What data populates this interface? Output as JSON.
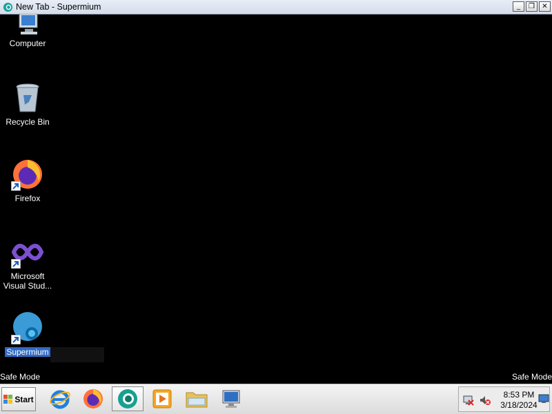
{
  "window": {
    "title": "New Tab - Supermium",
    "app_icon": "supermium-icon"
  },
  "desktop": {
    "icons": [
      {
        "label": "Computer",
        "icon": "computer-icon"
      },
      {
        "label": "Recycle Bin",
        "icon": "recycle-bin-icon"
      },
      {
        "label": "Firefox",
        "icon": "firefox-icon"
      },
      {
        "label": "Microsoft Visual Stud...",
        "icon": "visual-studio-icon"
      },
      {
        "label": "Supermium",
        "icon": "supermium-icon",
        "selected": true
      }
    ],
    "safe_mode_left": "Safe Mode",
    "safe_mode_right": "Safe Mode"
  },
  "taskbar": {
    "start_label": "Start",
    "pinned": [
      "internet-explorer-icon",
      "firefox-icon",
      "supermium-icon",
      "media-player-icon",
      "file-explorer-icon",
      "remote-desktop-icon"
    ],
    "active": "supermium-icon"
  },
  "tray": {
    "time": "8:53 PM",
    "date": "3/18/2024",
    "icons": [
      "network-error-icon",
      "volume-muted-icon",
      "show-desktop-icon"
    ]
  },
  "colors": {
    "desktop_bg": "#000000",
    "selection": "#316ac5"
  }
}
